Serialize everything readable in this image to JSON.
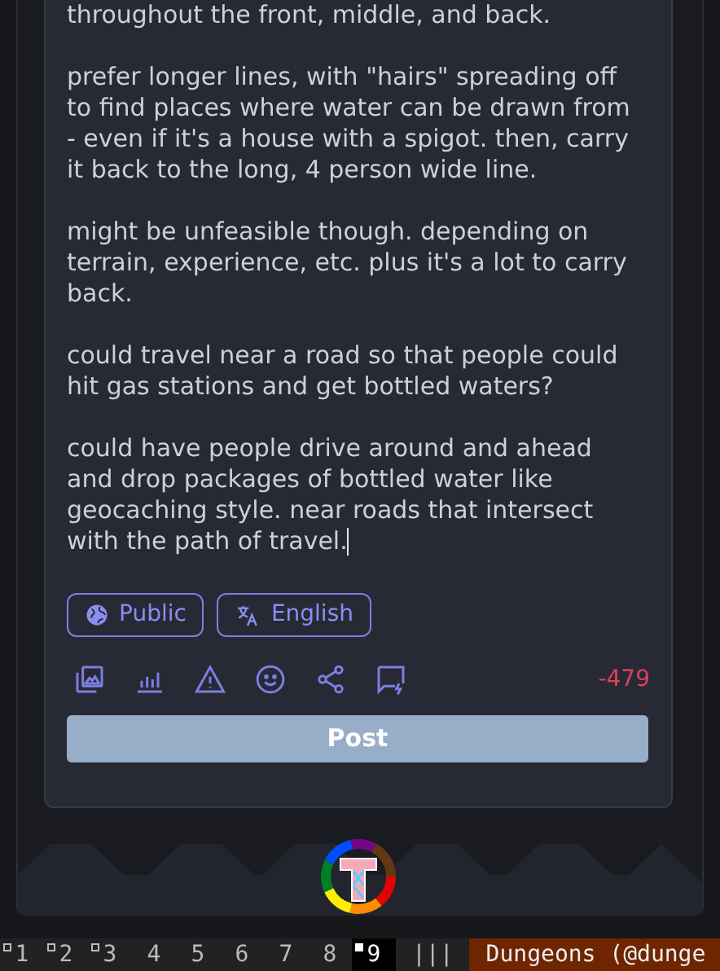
{
  "post_editor": {
    "paragraphs": [
      "throughout the front, middle, and back.",
      "prefer longer lines, with \"hairs\" spreading off to find places where water can be drawn from - even if it's a house with a spigot. then, carry it back to the long, 4 person wide line.",
      "might be unfeasible though. depending on terrain, experience, etc. plus it's a lot to carry back.",
      "could travel near a road so that people could hit gas stations and get bottled waters?",
      "could have people drive around and ahead and drop packages of bottled water like geocaching style. near roads that intersect with the path of travel."
    ],
    "visibility": "Public",
    "language": "English",
    "char_count": "-479",
    "post_button": {
      "label": "Post",
      "disabled": true
    }
  },
  "taskbar": {
    "workspaces": [
      {
        "label": "1",
        "occupied": true,
        "selected": false
      },
      {
        "label": "2",
        "occupied": true,
        "selected": false
      },
      {
        "label": "3",
        "occupied": true,
        "selected": false
      },
      {
        "label": "4",
        "occupied": false,
        "selected": false
      },
      {
        "label": "5",
        "occupied": false,
        "selected": false
      },
      {
        "label": "6",
        "occupied": false,
        "selected": false
      },
      {
        "label": "7",
        "occupied": false,
        "selected": false
      },
      {
        "label": "8",
        "occupied": false,
        "selected": false
      },
      {
        "label": "9",
        "occupied": true,
        "selected": true
      }
    ],
    "layout": "|||",
    "window_title": "Dungeons (@dunge"
  }
}
